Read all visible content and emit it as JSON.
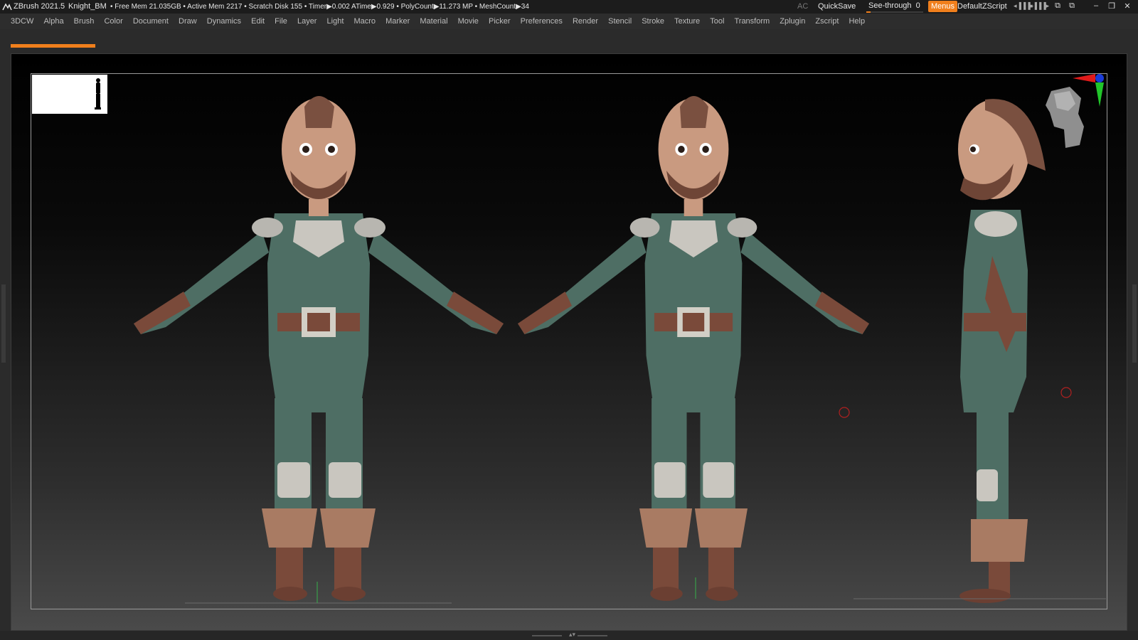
{
  "titlebar": {
    "app_name": "ZBrush 2021.5",
    "document_name": "Knight_BM",
    "status_line": "• Free Mem 21.035GB • Active Mem 2217 • Scratch Disk 155 • Timer▶0.002 ATime▶0.929 • PolyCount▶11.273 MP • MeshCount▶34",
    "ac_label": "AC",
    "quicksave_label": "QuickSave",
    "seethrough_label": "See-through",
    "seethrough_value": "0",
    "seethrough_fraction": 0.08,
    "menus_label": "Menus",
    "script_label": "DefaultZScript"
  },
  "menubar": {
    "items": [
      "3DCW",
      "Alpha",
      "Brush",
      "Color",
      "Document",
      "Draw",
      "Dynamics",
      "Edit",
      "File",
      "Layer",
      "Light",
      "Macro",
      "Marker",
      "Material",
      "Movie",
      "Picker",
      "Preferences",
      "Render",
      "Stencil",
      "Stroke",
      "Texture",
      "Tool",
      "Transform",
      "Zplugin",
      "Zscript",
      "Help"
    ]
  },
  "icons": {
    "zbrush_logo": "zbrush-logo-icon",
    "minimize": "minimize-icon",
    "restore": "restore-icon",
    "close": "close-icon",
    "navigation_cube": "head-navigation-icon",
    "axis_gizmo": "axis-gizmo-icon"
  },
  "colors": {
    "accent": "#f07f1c",
    "tunic": "#4e6e64",
    "leather": "#7a4a3a",
    "skin": "#c99a80",
    "metal": "#c9c6bf"
  }
}
